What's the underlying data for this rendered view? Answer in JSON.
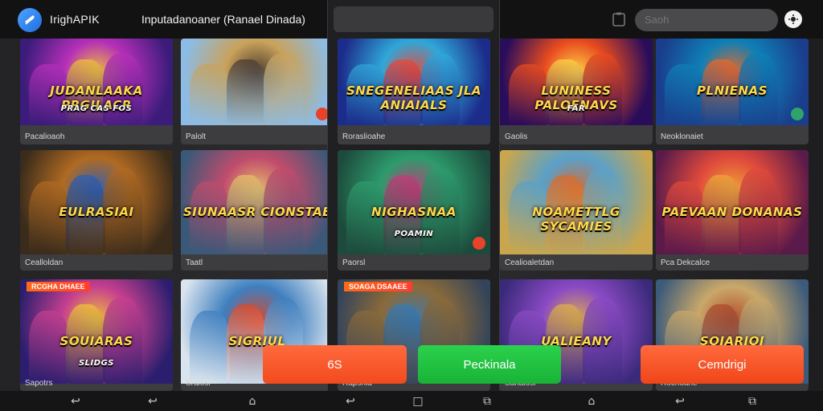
{
  "header": {
    "app_name": "IrighAPIK",
    "page_title": "Inputadanoaner (Ranael Dinada)",
    "search_placeholder": "Saoh"
  },
  "tiles": [
    {
      "title": "JUDANLAAKA PRGILACR",
      "subtitle": "PRAG CAS FOS",
      "caption": "Pacalioaoh",
      "colors": [
        "#3b1c7a",
        "#b42fb8",
        "#f0c13a"
      ]
    },
    {
      "title": "",
      "caption": "Palolt",
      "colors": [
        "#8cbce6",
        "#c9a25c",
        "#4b3a2b"
      ]
    },
    {
      "title": "SNEGENELIAAS JLA ANIAIALS",
      "caption": "Roraslioahe",
      "colors": [
        "#1c2c8a",
        "#2fa7d9",
        "#e94a3b"
      ]
    },
    {
      "title": "LUNINESS PALOENAVS",
      "subtitle": "FAR",
      "caption": "Gaolis",
      "colors": [
        "#2a0d5a",
        "#e84b1f",
        "#ffd447"
      ]
    },
    {
      "title": "PLNIENAS",
      "caption": "Neoklonaiet",
      "colors": [
        "#1a3e8c",
        "#0f7fb5",
        "#e8692a"
      ]
    },
    {
      "title": "EULRASIAI",
      "caption": "Cealloldan",
      "colors": [
        "#3a2b1b",
        "#b06a22",
        "#2f5fb5"
      ]
    },
    {
      "title": "SIUNAASR CIONSTAE",
      "caption": "Taatl",
      "colors": [
        "#3a5878",
        "#c04c6c",
        "#e8c06a"
      ]
    },
    {
      "title": "NIGHASNAA",
      "subtitle": "POAMIN",
      "caption": "Paorsl",
      "colors": [
        "#1d4a3c",
        "#2d9b6c",
        "#c43b7a"
      ]
    },
    {
      "title": "NOAMETTLG SYCAMIES",
      "caption": "Cealioaletdan",
      "colors": [
        "#c9a64d",
        "#5aa0c9",
        "#d86a2f"
      ]
    },
    {
      "title": "PAEVAAN DONANAS",
      "caption": "Pca Dekcalce",
      "colors": [
        "#5a1a4a",
        "#e04a3b",
        "#f0a73a"
      ]
    },
    {
      "title": "SOUIARAS",
      "subtitle": "SLIDGS",
      "ribbon": "RCGHA DHAEE",
      "caption": "Sapotrs",
      "colors": [
        "#2b1e6e",
        "#c63f8f",
        "#f2c23a"
      ]
    },
    {
      "title": "SIGRIUL",
      "caption": "Sralosl",
      "colors": [
        "#d9e4ee",
        "#3f7fbf",
        "#d8492b"
      ]
    },
    {
      "title": "",
      "ribbon": "SOAGA DSAAEE",
      "caption": "Rapsnia",
      "colors": [
        "#32435a",
        "#8a6a3a",
        "#3b7ab0"
      ]
    },
    {
      "title": "UALIEANY",
      "caption": "Sanalosl",
      "colors": [
        "#3a2a7a",
        "#8a4ac4",
        "#e0b04a"
      ]
    },
    {
      "title": "SOIARIOI",
      "caption": "Rochoahe",
      "colors": [
        "#3c5a7a",
        "#c9a86a",
        "#b04a2a"
      ]
    }
  ],
  "actions": {
    "primary_label": "6S",
    "middle_label": "Peckinala",
    "right_label": "Cemdrigi"
  },
  "nav": [
    "back-icon",
    "back-icon",
    "home-icon",
    "back-icon",
    "square-icon",
    "recent-icon",
    "home-icon",
    "back-icon",
    "recent-icon"
  ]
}
